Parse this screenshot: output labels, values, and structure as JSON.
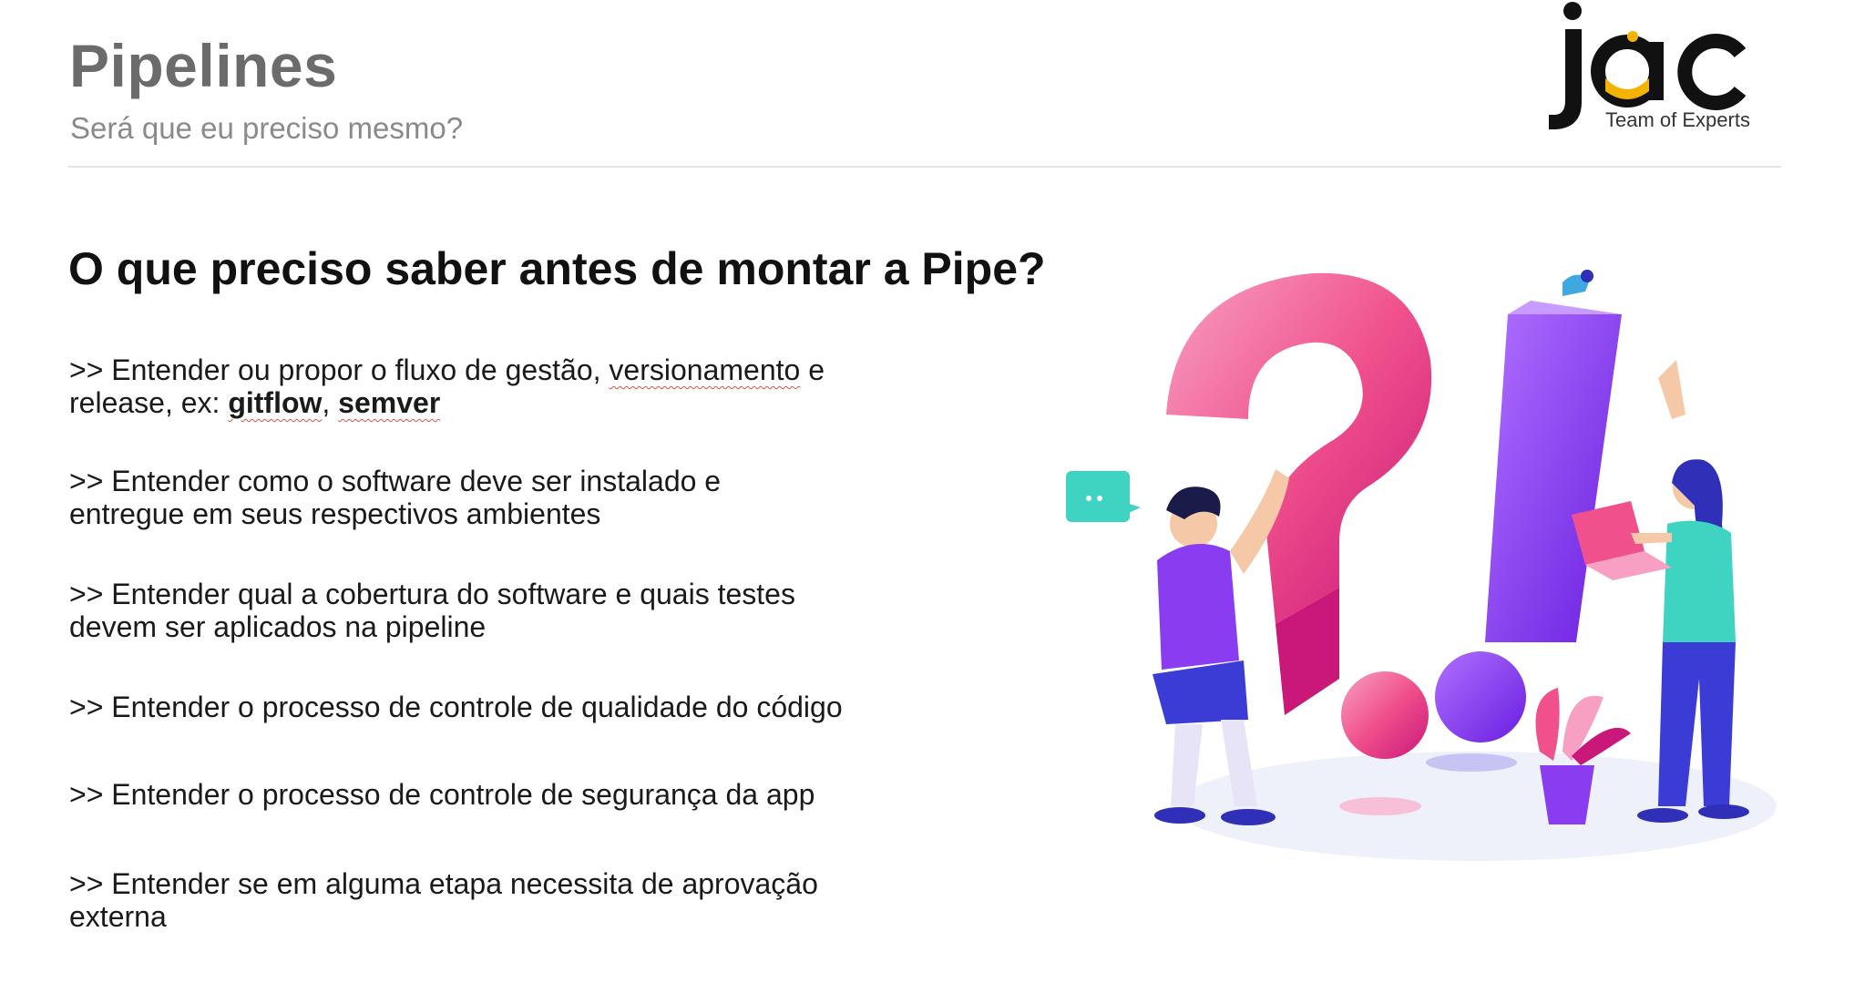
{
  "header": {
    "title": "Pipelines",
    "subtitle": "Será que eu preciso mesmo?"
  },
  "logo": {
    "wordmark": "jac",
    "tagline": "Team of Experts"
  },
  "content": {
    "heading": "O que preciso saber antes de montar a Pipe?",
    "bullets": [
      {
        "line1_pre": ">> Entender ou propor o fluxo de gestão, ",
        "line1_squiggle": "versionamento",
        "line1_post": " e",
        "line2_pre": "release, ex: ",
        "line2_bold1": "gitflow",
        "line2_mid": ", ",
        "line2_bold2": "semver"
      },
      {
        "line1": ">> Entender como o software deve ser instalado e",
        "line2": "entregue em seus respectivos ambientes"
      },
      {
        "line1": ">> Entender qual a cobertura do software e quais testes",
        "line2": "devem ser aplicados na pipeline"
      },
      {
        "line1": ">> Entender o processo de controle de qualidade do código"
      },
      {
        "line1": ">> Entender o processo de controle de segurança da app"
      },
      {
        "line1": ">> Entender se em alguma etapa necessita de aprovação",
        "line2": "externa"
      }
    ]
  },
  "colors": {
    "title_gray": "#6b6b6b",
    "pink": "#f0508c",
    "purple": "#8a3cf0",
    "teal": "#3fd3c2",
    "navy": "#2f2fb8",
    "logo_yellow": "#f2b400"
  },
  "illustration": {
    "icon": "question-exclamation-people-illustration"
  }
}
